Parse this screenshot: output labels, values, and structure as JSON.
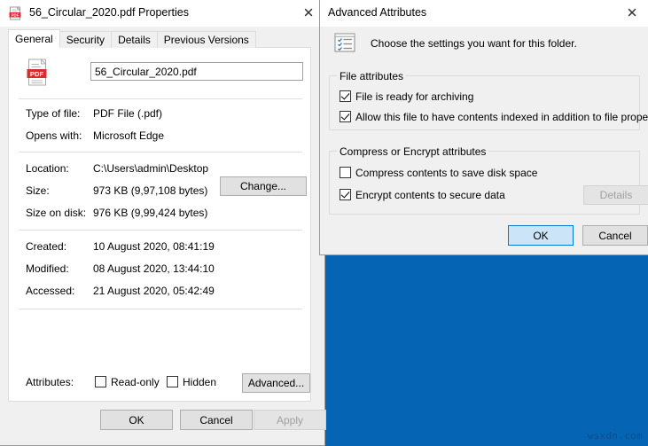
{
  "desktop": {
    "background_color": "#0664b4",
    "watermark": "wsxdn.com"
  },
  "properties_window": {
    "title": "56_Circular_2020.pdf Properties",
    "title_icon": "pdf-file-icon",
    "close_icon": "close-icon",
    "tabs": [
      {
        "label": "General",
        "selected": true
      },
      {
        "label": "Security",
        "selected": false
      },
      {
        "label": "Details",
        "selected": false
      },
      {
        "label": "Previous Versions",
        "selected": false
      }
    ],
    "file_icon": "pdf-document-icon",
    "filename_value": "56_Circular_2020.pdf",
    "rows": [
      {
        "label": "Type of file:",
        "value": "PDF File (.pdf)"
      },
      {
        "label": "Opens with:",
        "value": "Microsoft Edge"
      },
      {
        "label": "Location:",
        "value": "C:\\Users\\admin\\Desktop"
      },
      {
        "label": "Size:",
        "value": "973 KB (9,97,108 bytes)"
      },
      {
        "label": "Size on disk:",
        "value": "976 KB (9,99,424 bytes)"
      },
      {
        "label": "Created:",
        "value": "10 August 2020, 08:41:19"
      },
      {
        "label": "Modified:",
        "value": "08 August 2020, 13:44:10"
      },
      {
        "label": "Accessed:",
        "value": "21 August 2020, 05:42:49"
      }
    ],
    "change_button": "Change...",
    "attributes_label": "Attributes:",
    "attributes": [
      {
        "label": "Read-only",
        "checked": false
      },
      {
        "label": "Hidden",
        "checked": false
      }
    ],
    "advanced_button": "Advanced...",
    "footer": {
      "ok": "OK",
      "cancel": "Cancel",
      "apply": "Apply",
      "apply_disabled": true
    }
  },
  "advanced_dialog": {
    "title": "Advanced Attributes",
    "close_icon": "close-icon",
    "head_icon": "settings-list-icon",
    "head_text": "Choose the settings you want for this folder.",
    "file_attributes_group": {
      "legend": "File attributes",
      "items": [
        {
          "label": "File is ready for archiving",
          "checked": true
        },
        {
          "label": "Allow this file to have contents indexed in addition to file properties",
          "checked": true
        }
      ]
    },
    "compress_group": {
      "legend": "Compress or Encrypt attributes",
      "items": [
        {
          "label": "Compress contents to save disk space",
          "checked": false
        },
        {
          "label": "Encrypt contents to secure data",
          "checked": true
        }
      ],
      "details_button": "Details",
      "details_disabled": true
    },
    "footer": {
      "ok": "OK",
      "cancel": "Cancel"
    }
  }
}
